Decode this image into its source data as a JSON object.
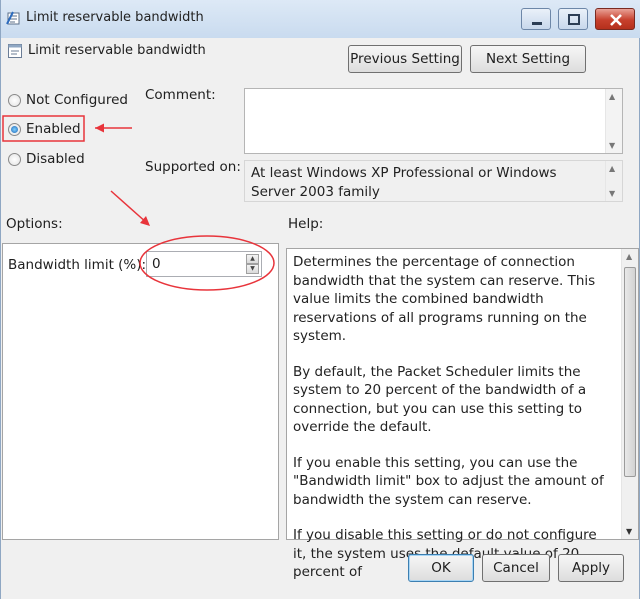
{
  "window": {
    "title": "Limit reservable bandwidth",
    "controls": [
      "minimize-icon",
      "maximize-icon",
      "close-icon"
    ]
  },
  "header": {
    "setting_title": "Limit reservable bandwidth",
    "previous_label": "Previous Setting",
    "next_label": "Next Setting"
  },
  "state": {
    "options": [
      {
        "label": "Not Configured",
        "checked": false
      },
      {
        "label": "Enabled",
        "checked": true
      },
      {
        "label": "Disabled",
        "checked": false
      }
    ]
  },
  "comment": {
    "label": "Comment:",
    "value": ""
  },
  "supported": {
    "label": "Supported on:",
    "value": "At least Windows XP Professional or Windows Server 2003 family"
  },
  "options_section": {
    "label": "Options:",
    "field_label": "Bandwidth limit (%):",
    "field_value": "0"
  },
  "help_section": {
    "label": "Help:",
    "paragraphs": [
      "Determines the percentage of connection bandwidth that the system can reserve. This value limits the combined bandwidth reservations of all programs running on the system.",
      "By default, the Packet Scheduler limits the system to 20 percent of the bandwidth of a connection, but you can use this setting to override the default.",
      "If you enable this setting, you can use the \"Bandwidth limit\" box to adjust the amount of bandwidth the system can reserve.",
      "If you disable this setting or do not configure it, the system uses the default value of 20 percent of"
    ]
  },
  "footer": {
    "ok_label": "OK",
    "cancel_label": "Cancel",
    "apply_label": "Apply"
  },
  "colors": {
    "annotation": "#e8343b",
    "selected_radio": "#1b62b4"
  }
}
